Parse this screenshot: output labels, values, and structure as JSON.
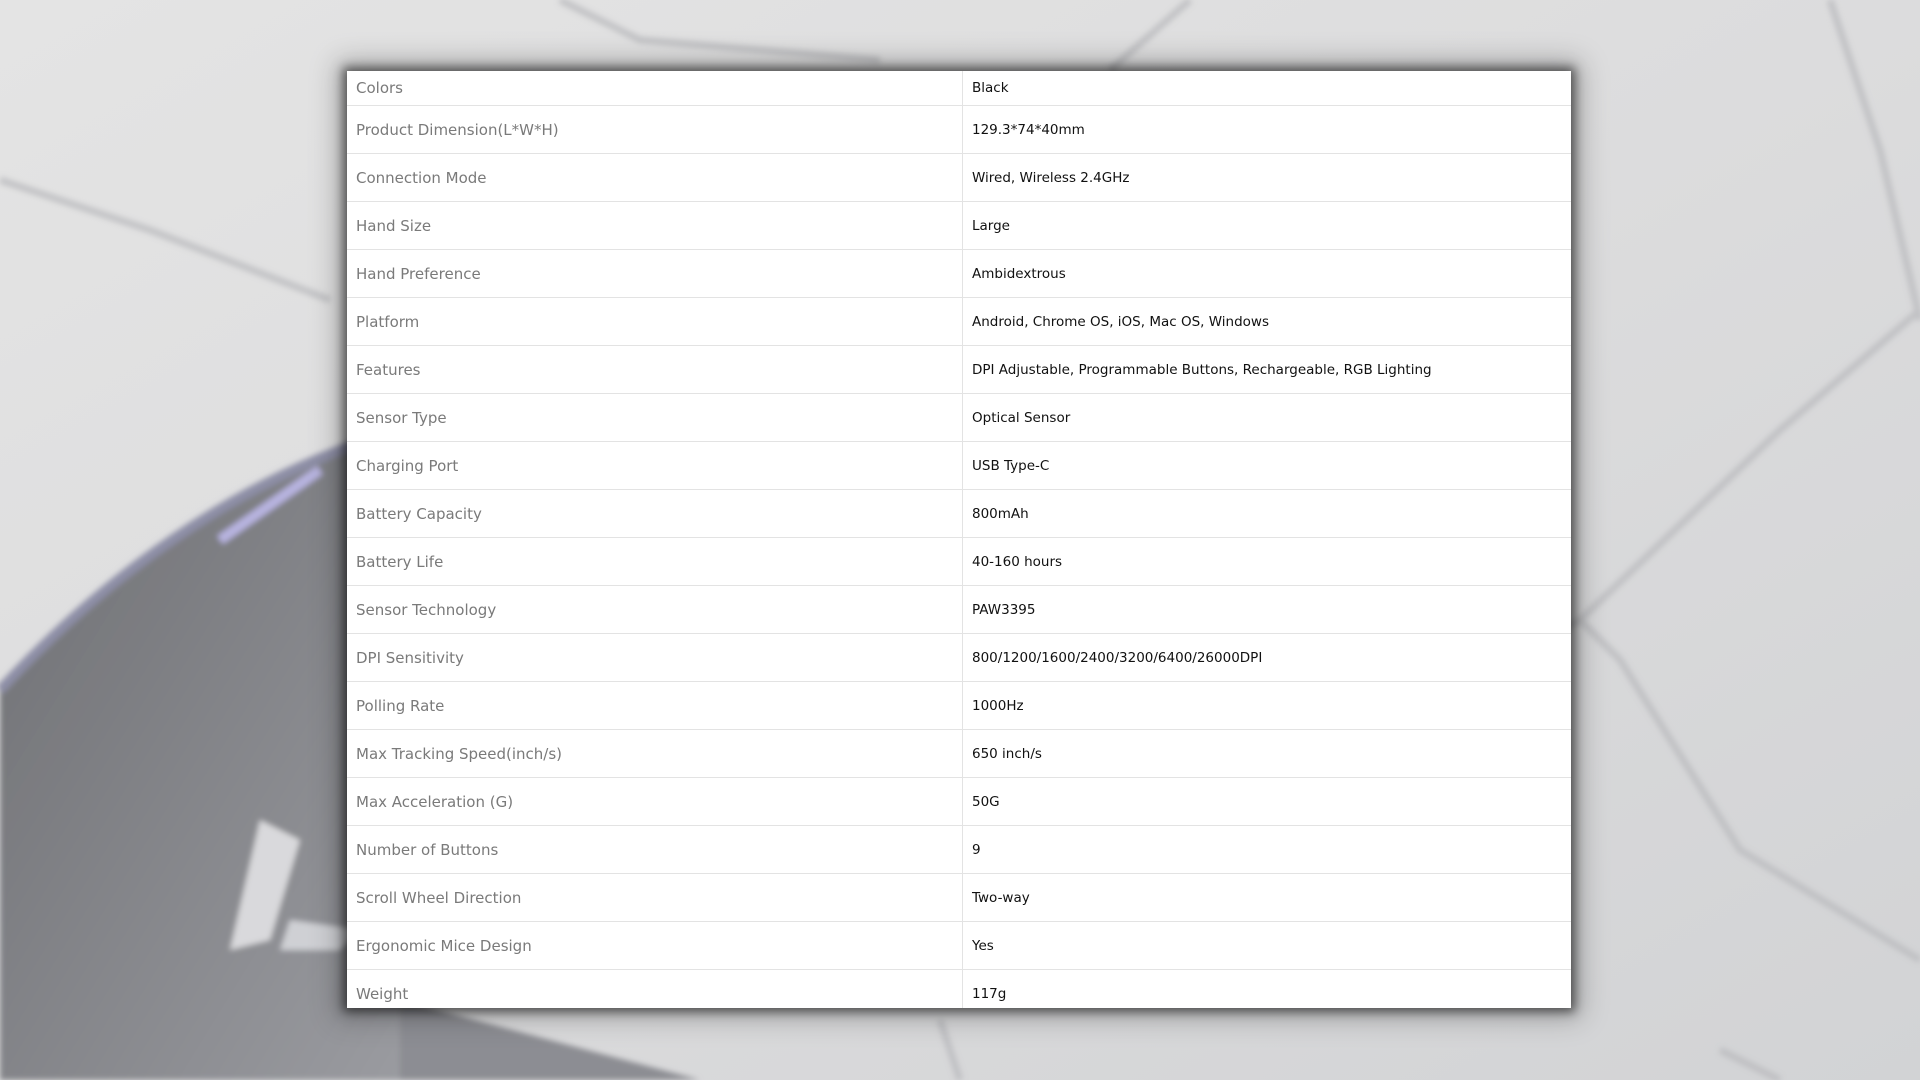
{
  "specs": [
    {
      "label": "Colors",
      "value": "Black"
    },
    {
      "label": "Product Dimension(L*W*H)",
      "value": "129.3*74*40mm"
    },
    {
      "label": "Connection Mode",
      "value": "Wired, Wireless 2.4GHz"
    },
    {
      "label": "Hand Size",
      "value": "Large"
    },
    {
      "label": "Hand Preference",
      "value": "Ambidextrous"
    },
    {
      "label": "Platform",
      "value": "Android, Chrome OS, iOS, Mac OS, Windows"
    },
    {
      "label": "Features",
      "value": "DPI Adjustable, Programmable Buttons, Rechargeable, RGB Lighting"
    },
    {
      "label": "Sensor Type",
      "value": "Optical Sensor"
    },
    {
      "label": "Charging Port",
      "value": "USB Type-C"
    },
    {
      "label": "Battery Capacity",
      "value": "800mAh"
    },
    {
      "label": "Battery Life",
      "value": "40-160 hours"
    },
    {
      "label": "Sensor Technology",
      "value": "PAW3395"
    },
    {
      "label": "DPI Sensitivity",
      "value": "800/1200/1600/2400/3200/6400/26000DPI"
    },
    {
      "label": "Polling Rate",
      "value": "1000Hz"
    },
    {
      "label": "Max Tracking Speed(inch/s)",
      "value": "650 inch/s"
    },
    {
      "label": "Max Acceleration (G)",
      "value": "50G"
    },
    {
      "label": "Number of Buttons",
      "value": "9"
    },
    {
      "label": "Scroll Wheel Direction",
      "value": "Two-way"
    },
    {
      "label": "Ergonomic Mice Design",
      "value": "Yes"
    },
    {
      "label": "Weight",
      "value": "117g"
    }
  ]
}
